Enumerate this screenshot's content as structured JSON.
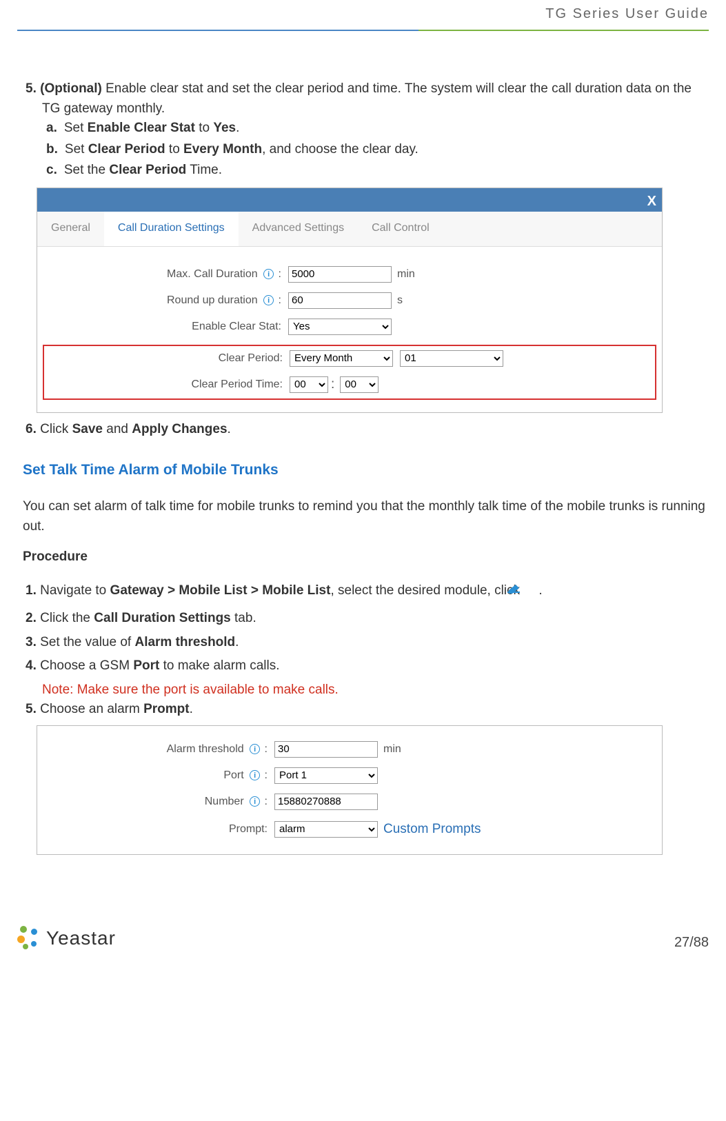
{
  "header": {
    "title": "TG  Series  User  Guide"
  },
  "step5": {
    "num": "5.",
    "lead_bold": "(Optional)",
    "text1": " Enable clear stat and set the clear period and time. The system will clear the call duration data on the TG gateway monthly.",
    "a": {
      "num": "a.",
      "pre": "Set ",
      "b1": "Enable Clear Stat",
      "mid": " to ",
      "b2": "Yes",
      "post": "."
    },
    "b": {
      "num": "b.",
      "pre": "Set ",
      "b1": "Clear Period",
      "mid": " to ",
      "b2": "Every Month",
      "post": ", and choose the clear day."
    },
    "c": {
      "num": "c.",
      "pre": "Set the ",
      "b1": "Clear Period",
      "post": " Time."
    }
  },
  "fig1": {
    "close": "X",
    "tabs": {
      "general": "General",
      "cds": "Call Duration Settings",
      "adv": "Advanced Settings",
      "cc": "Call Control"
    },
    "maxcall_label": "Max. Call Duration",
    "maxcall_val": "5000",
    "maxcall_unit": "min",
    "round_label": "Round up duration",
    "round_val": "60",
    "round_unit": "s",
    "enable_label": "Enable Clear Stat:",
    "enable_val": "Yes",
    "cp_label": "Clear Period:",
    "cp_val": "Every Month",
    "cp_day": "01",
    "cpt_label": "Clear Period Time:",
    "cpt_h": "00",
    "cpt_m": "00"
  },
  "step6": {
    "num": "6.",
    "pre": "Click ",
    "b1": "Save",
    "mid": " and ",
    "b2": "Apply Changes",
    "post": "."
  },
  "section2_title": "Set Talk Time Alarm of Mobile Trunks",
  "para2": "You can set alarm of talk time for mobile trunks to remind you that the monthly talk time of the mobile trunks is running out.",
  "proc": "Procedure",
  "p1": {
    "num": "1.",
    "pre": "Navigate to ",
    "b1": "Gateway > Mobile List > Mobile List",
    "post": ", select the desired module, click ",
    "end": "."
  },
  "p2": {
    "num": "2.",
    "pre": "Click the ",
    "b1": "Call Duration Settings",
    "post": " tab."
  },
  "p3": {
    "num": "3.",
    "pre": "Set the value of ",
    "b1": "Alarm threshold",
    "post": "."
  },
  "p4": {
    "num": "4.",
    "pre": "Choose a GSM ",
    "b1": "Port",
    "post": " to make alarm calls."
  },
  "p4note": "Note: Make sure the port is available to make calls.",
  "p5": {
    "num": "5.",
    "pre": "Choose an alarm ",
    "b1": "Prompt",
    "post": "."
  },
  "fig2": {
    "alarm_label": "Alarm threshold",
    "alarm_val": "30",
    "alarm_unit": "min",
    "port_label": "Port",
    "port_val": "Port 1",
    "number_label": "Number",
    "number_val": "15880270888",
    "prompt_label": "Prompt:",
    "prompt_val": "alarm",
    "prompt_link": "Custom Prompts"
  },
  "footer": {
    "brand": "Yeastar",
    "page": "27/88"
  }
}
